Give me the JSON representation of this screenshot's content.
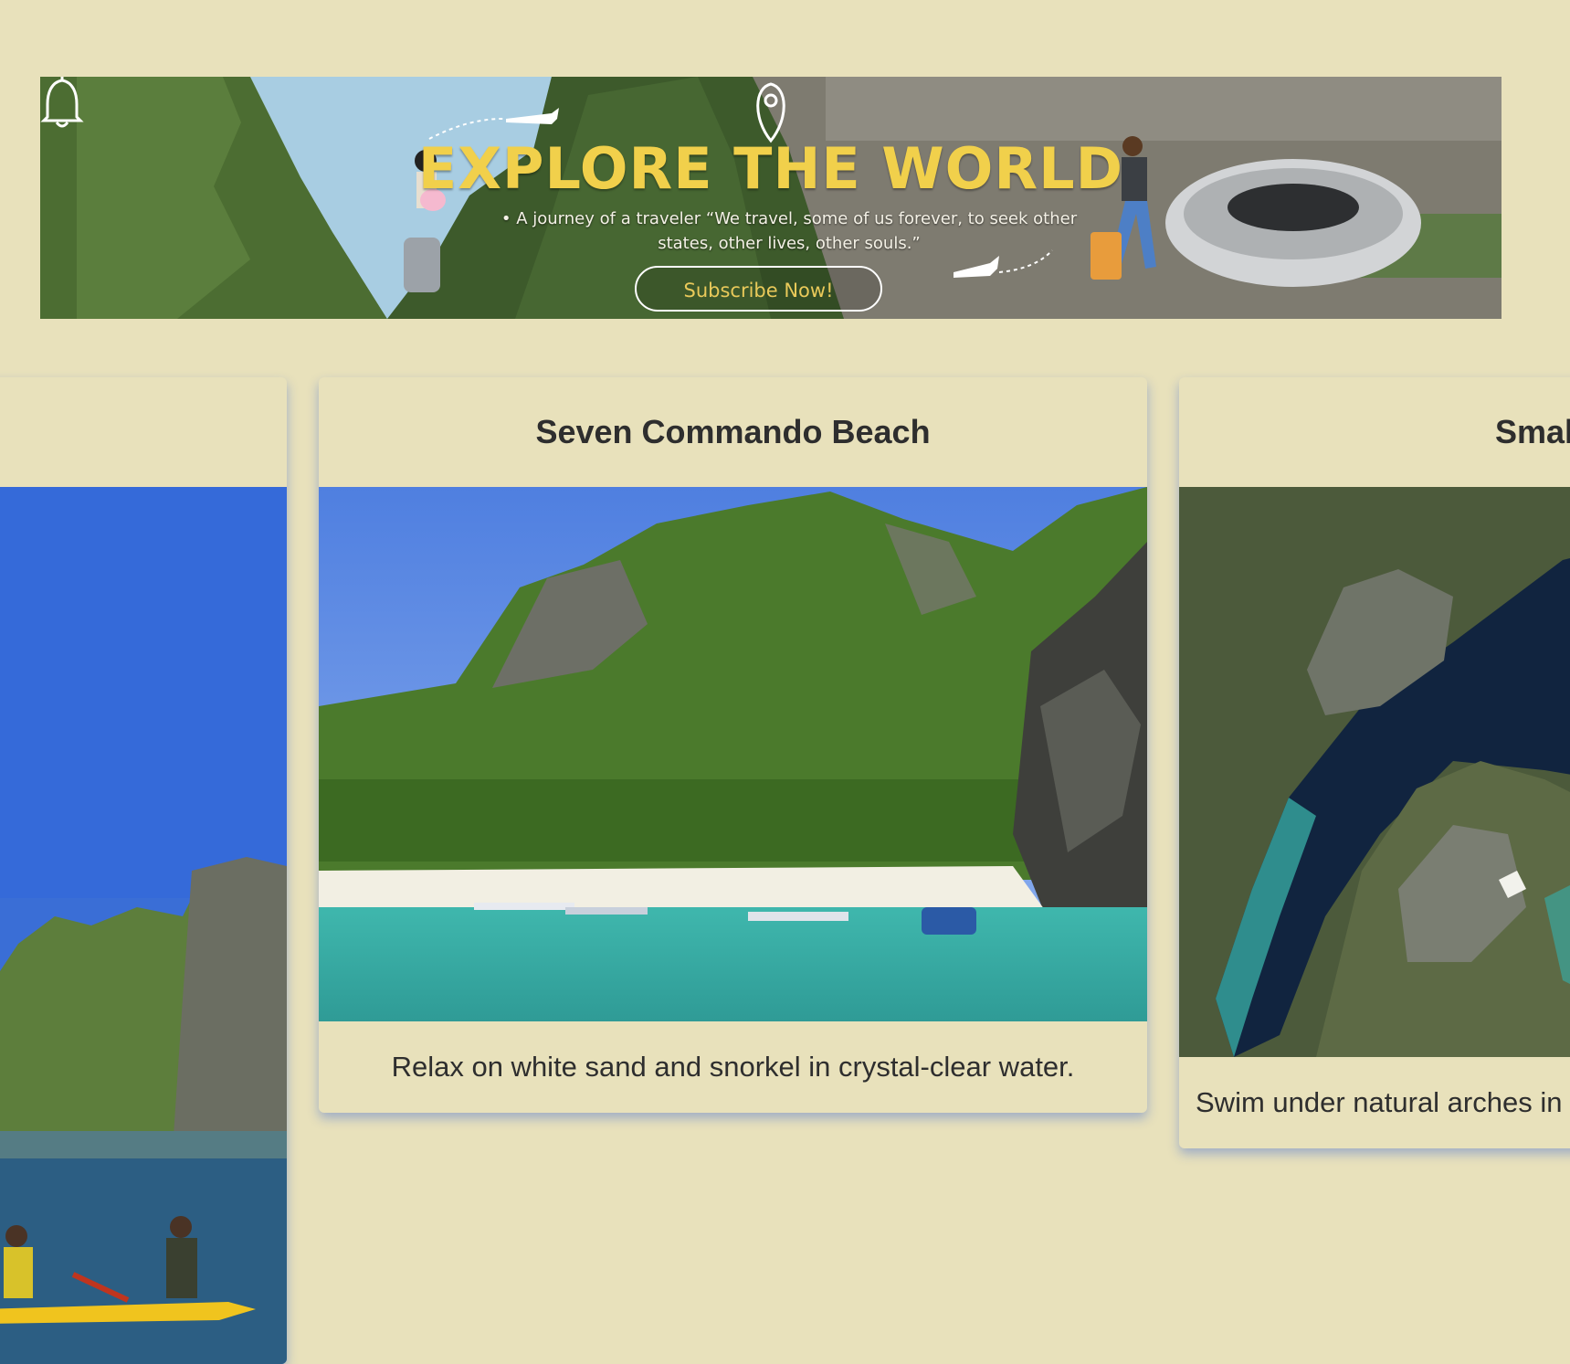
{
  "banner": {
    "title": "EXPLORE THE WORLD",
    "quote": "• A journey of a traveler “We travel, some of us forever, to seek other states, other lives, other souls.”",
    "subscribe_label": "Subscribe Now!"
  },
  "cards": [
    {
      "title": "",
      "description": ""
    },
    {
      "title": "Seven Commando Beach",
      "description": "Relax on white sand and snorkel in crystal-clear water."
    },
    {
      "title": "Smal",
      "description": "Swim under natural arches in"
    }
  ],
  "colors": {
    "page_background": "#e8e1bb",
    "banner_title": "#f1d04b",
    "card_shadow": "#466ed2"
  }
}
